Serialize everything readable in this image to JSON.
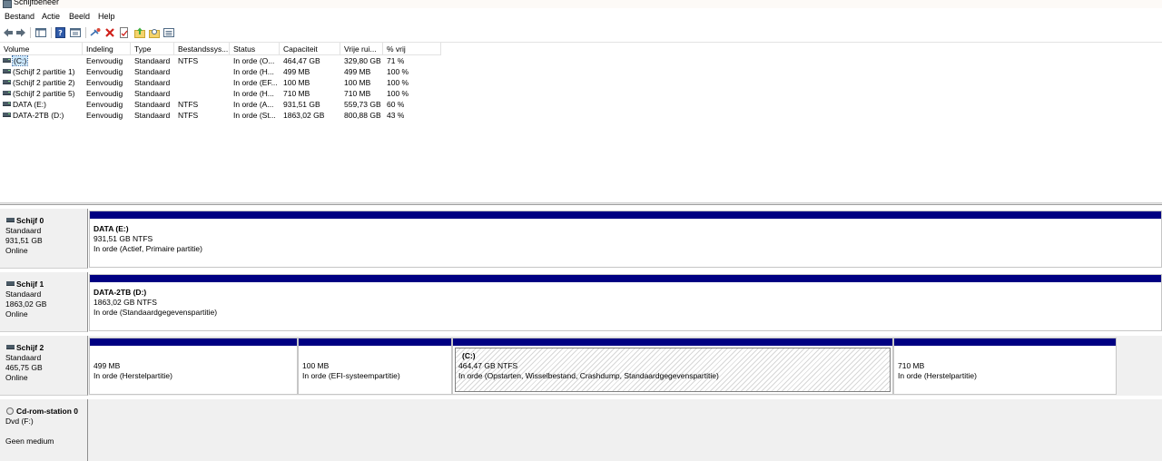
{
  "window": {
    "title": "Schijfbeheer"
  },
  "menu": [
    "Bestand",
    "Actie",
    "Beeld",
    "Help"
  ],
  "toolbar": {
    "icons": [
      "back-arrow-icon",
      "forward-arrow-icon",
      "console-tree-icon",
      "help-icon",
      "properties-icon",
      "connect-icon",
      "delete-icon",
      "checklist-icon",
      "folder-up-icon",
      "search-folder-icon",
      "view-icon"
    ]
  },
  "volume_list": {
    "columns": [
      "Volume",
      "Indeling",
      "Type",
      "Bestandssys...",
      "Status",
      "Capaciteit",
      "Vrije rui...",
      "% vrij"
    ],
    "rows": [
      {
        "volume": "(C:)",
        "layout": "Eenvoudig",
        "type": "Standaard",
        "fs": "NTFS",
        "status": "In orde (O...",
        "capacity": "464,47 GB",
        "free": "329,80 GB",
        "pct": "71 %"
      },
      {
        "volume": "(Schijf 2 partitie 1)",
        "layout": "Eenvoudig",
        "type": "Standaard",
        "fs": "",
        "status": "In orde (H...",
        "capacity": "499 MB",
        "free": "499 MB",
        "pct": "100 %"
      },
      {
        "volume": "(Schijf 2 partitie 2)",
        "layout": "Eenvoudig",
        "type": "Standaard",
        "fs": "",
        "status": "In orde (EF...",
        "capacity": "100 MB",
        "free": "100 MB",
        "pct": "100 %"
      },
      {
        "volume": "(Schijf 2 partitie 5)",
        "layout": "Eenvoudig",
        "type": "Standaard",
        "fs": "",
        "status": "In orde (H...",
        "capacity": "710 MB",
        "free": "710 MB",
        "pct": "100 %"
      },
      {
        "volume": "DATA (E:)",
        "layout": "Eenvoudig",
        "type": "Standaard",
        "fs": "NTFS",
        "status": "In orde (A...",
        "capacity": "931,51 GB",
        "free": "559,73 GB",
        "pct": "60 %"
      },
      {
        "volume": "DATA-2TB (D:)",
        "layout": "Eenvoudig",
        "type": "Standaard",
        "fs": "NTFS",
        "status": "In orde (St...",
        "capacity": "1863,02 GB",
        "free": "800,88 GB",
        "pct": "43 %"
      }
    ]
  },
  "disks": [
    {
      "name": "Schijf 0",
      "kind": "Standaard",
      "size": "931,51 GB",
      "state": "Online",
      "partitions": [
        {
          "title": "DATA  (E:)",
          "line2": "931,51 GB NTFS",
          "line3": "In orde (Actief, Primaire partitie)"
        }
      ]
    },
    {
      "name": "Schijf 1",
      "kind": "Standaard",
      "size": "1863,02 GB",
      "state": "Online",
      "partitions": [
        {
          "title": "DATA-2TB  (D:)",
          "line2": "1863,02 GB NTFS",
          "line3": "In orde (Standaardgegevenspartitie)"
        }
      ]
    },
    {
      "name": "Schijf 2",
      "kind": "Standaard",
      "size": "465,75 GB",
      "state": "Online",
      "partitions": [
        {
          "line2": "499 MB",
          "line3": "In orde (Herstelpartitie)"
        },
        {
          "line2": "100 MB",
          "line3": "In orde (EFI-systeempartitie)"
        },
        {
          "title": "(C:)",
          "line2": "464,47 GB NTFS",
          "line3": "In orde (Opstarten, Wisselbestand, Crashdump, Standaardgegevenspartitie)"
        },
        {
          "line2": "710 MB",
          "line3": "In orde (Herstelpartitie)"
        }
      ]
    }
  ],
  "cdrom": {
    "name": "Cd-rom-station 0",
    "drive": "Dvd (F:)",
    "state": "Geen medium"
  },
  "colors": {
    "partition_bar": "#000082",
    "selection": "#cce8ff",
    "window_bg": "#f0f0f0"
  }
}
